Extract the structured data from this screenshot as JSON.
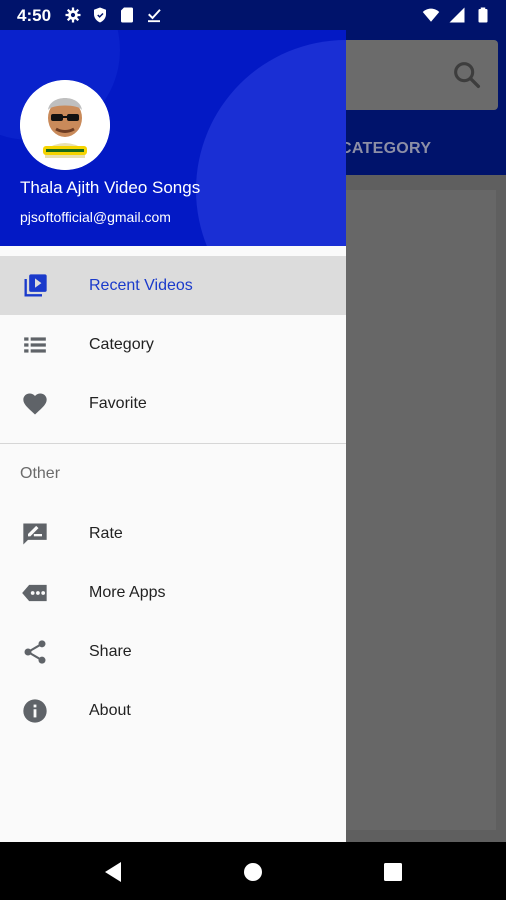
{
  "status_bar": {
    "time": "4:50",
    "left_icons": [
      "gear-icon",
      "shield-icon",
      "sd-card-icon",
      "download-done-icon"
    ],
    "right_icons": [
      "wifi-icon",
      "cell-signal-icon",
      "battery-icon"
    ]
  },
  "background_app": {
    "tab_label": "CATEGORY",
    "search_icon": "search-icon"
  },
  "drawer": {
    "header": {
      "app_name": "Thala Ajith Video Songs",
      "email": "pjsoftofficial@gmail.com",
      "avatar_icon": "app-logo-icon"
    },
    "primary_items": [
      {
        "label": "Recent Videos",
        "icon": "video-library-icon",
        "active": true
      },
      {
        "label": "Category",
        "icon": "list-icon",
        "active": false
      },
      {
        "label": "Favorite",
        "icon": "heart-icon",
        "active": false
      }
    ],
    "section_title": "Other",
    "secondary_items": [
      {
        "label": "Rate",
        "icon": "rate-review-icon"
      },
      {
        "label": "More Apps",
        "icon": "more-apps-icon"
      },
      {
        "label": "Share",
        "icon": "share-icon"
      },
      {
        "label": "About",
        "icon": "info-icon"
      }
    ]
  },
  "colors": {
    "header_blue": "#0319c5",
    "status_bar_blue": "#00136b",
    "active_text": "#1a3acb",
    "active_bg": "#dcdcdc"
  }
}
